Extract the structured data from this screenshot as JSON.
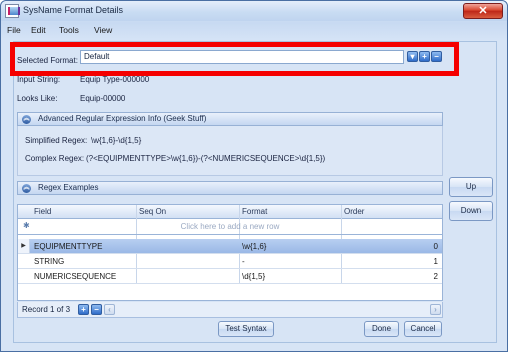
{
  "window": {
    "title": "SysName Format Details",
    "close_label": "✕"
  },
  "menu": [
    "File",
    "Edit",
    "Tools",
    "View"
  ],
  "format": {
    "label": "Selected Format:",
    "value": "Default",
    "dropdown_icon": "chevron-down-icon",
    "add_icon": "plus-icon",
    "remove_icon": "minus-icon"
  },
  "input_string": {
    "label": "Input String:",
    "value": "Equip Type-000000"
  },
  "looks_like": {
    "label": "Looks Like:",
    "value": "Equip-00000"
  },
  "regex_section": {
    "title": "Advanced Regular Expression Info (Geek Stuff)",
    "simplified_label": "Simplified Regex:",
    "simplified_value": "\\w{1,6}-\\d{1,5}",
    "complex_label": "Complex Regex:",
    "complex_value": "(?<EQUIPMENTTYPE>\\w{1,6})-(?<NUMERICSEQUENCE>\\d{1,5})"
  },
  "examples_section": {
    "title": "Regex Examples"
  },
  "grid": {
    "columns": [
      "Field",
      "Seq On",
      "Format",
      "Order"
    ],
    "add_row_text": "Click here to add a new row",
    "rows": [
      {
        "field": "EQUIPMENTTYPE",
        "seq_on": "",
        "format": "\\w{1,6}",
        "order": "0",
        "selected": true
      },
      {
        "field": "STRING",
        "seq_on": "",
        "format": "-",
        "order": "1",
        "selected": false
      },
      {
        "field": "NUMERICSEQUENCE",
        "seq_on": "",
        "format": "\\d{1,5}",
        "order": "2",
        "selected": false
      }
    ]
  },
  "pager": {
    "text": "Record 1 of 3"
  },
  "side_buttons": {
    "up": "Up",
    "down": "Down"
  },
  "footer": {
    "test_syntax": "Test Syntax",
    "done": "Done",
    "cancel": "Cancel"
  },
  "colors": {
    "highlight": "#f50000",
    "selected_row": "#a9c4ec",
    "accent": "#2f6cc9"
  }
}
